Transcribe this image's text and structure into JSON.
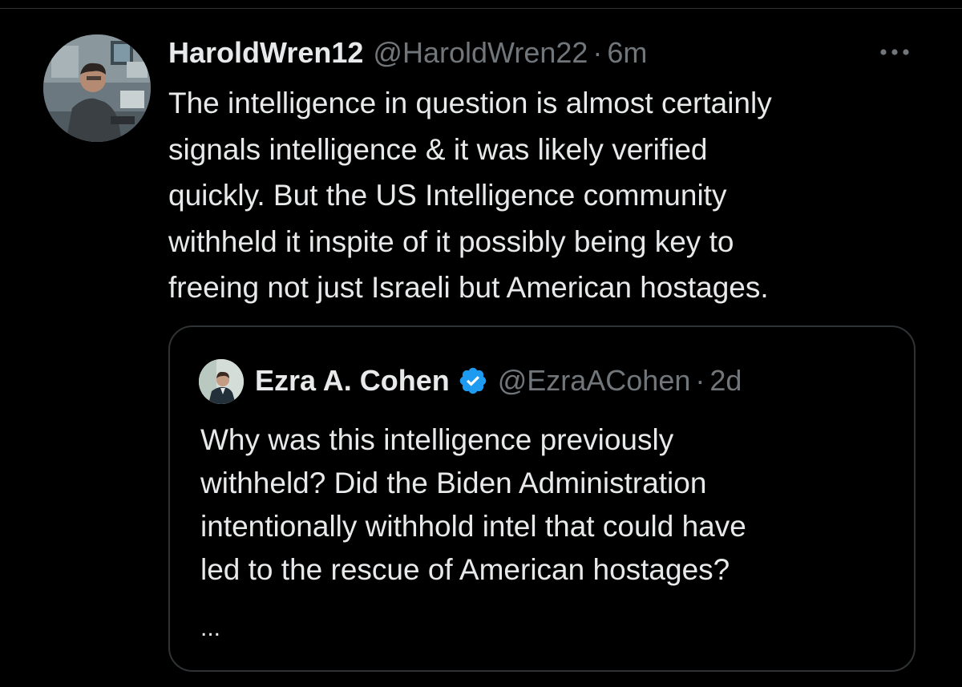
{
  "tweet": {
    "author": {
      "display_name": "HaroldWren12",
      "handle": "@HaroldWren22",
      "avatar": "profile-photo"
    },
    "separator": "·",
    "time": "6m",
    "more_icon": "more-horizontal-icon",
    "text": "The intelligence in question is almost certainly\nsignals intelligence & it was likely verified\nquickly. But the US Intelligence community\nwithheld it inspite of it possibly being key to\nfreeing not just Israeli but American hostages."
  },
  "quoted_tweet": {
    "author": {
      "display_name": "Ezra A. Cohen",
      "handle": "@EzraACohen",
      "verified_icon": "verified-badge-icon",
      "avatar": "profile-photo"
    },
    "separator": "·",
    "time": "2d",
    "text": "Why was this intelligence previously\nwithheld? Did the Biden Administration\nintentionally withhold intel that could have\nled to the rescue of American hostages?",
    "truncation": "..."
  },
  "colors": {
    "background": "#000000",
    "text_primary": "#e7e9ea",
    "text_secondary": "#71767b",
    "border": "#2f3336",
    "verified_blue": "#1d9bf0"
  }
}
